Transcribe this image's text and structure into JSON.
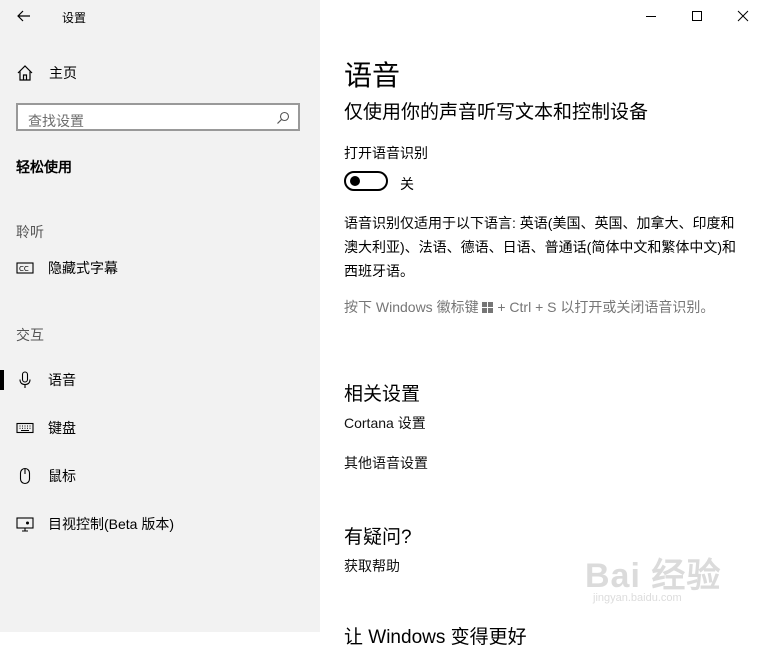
{
  "window": {
    "title": "设置"
  },
  "sidebar": {
    "home_label": "主页",
    "search_placeholder": "查找设置",
    "section_title": "轻松使用",
    "groups": {
      "hearing": "聆听",
      "interaction": "交互"
    },
    "items": [
      {
        "label": "隐藏式字幕",
        "icon": "closed-captions-icon"
      },
      {
        "label": "语音",
        "icon": "microphone-icon",
        "selected": true
      },
      {
        "label": "键盘",
        "icon": "keyboard-icon"
      },
      {
        "label": "鼠标",
        "icon": "mouse-icon"
      },
      {
        "label": "目视控制(Beta 版本)",
        "icon": "eye-control-icon"
      }
    ]
  },
  "main": {
    "title": "语音",
    "subtitle": "仅使用你的声音听写文本和控制设备",
    "toggle": {
      "label": "打开语音识别",
      "state_label": "关",
      "on": false
    },
    "description": "语音识别仅适用于以下语言: 英语(美国、英国、加拿大、印度和澳大利亚)、法语、德语、日语、普通话(简体中文和繁体中文)和西班牙语。",
    "shortcut_before": "按下 Windows 徽标键",
    "shortcut_after": "+ Ctrl + S 以打开或关闭语音识别。",
    "related_heading": "相关设置",
    "related_links": [
      "Cortana 设置",
      "其他语音设置"
    ],
    "question_heading": "有疑问?",
    "help_link": "获取帮助",
    "cut_heading": "让 Windows 变得更好"
  },
  "watermark": {
    "main": "Bai 经验",
    "sub": "jingyan.baidu.com"
  }
}
